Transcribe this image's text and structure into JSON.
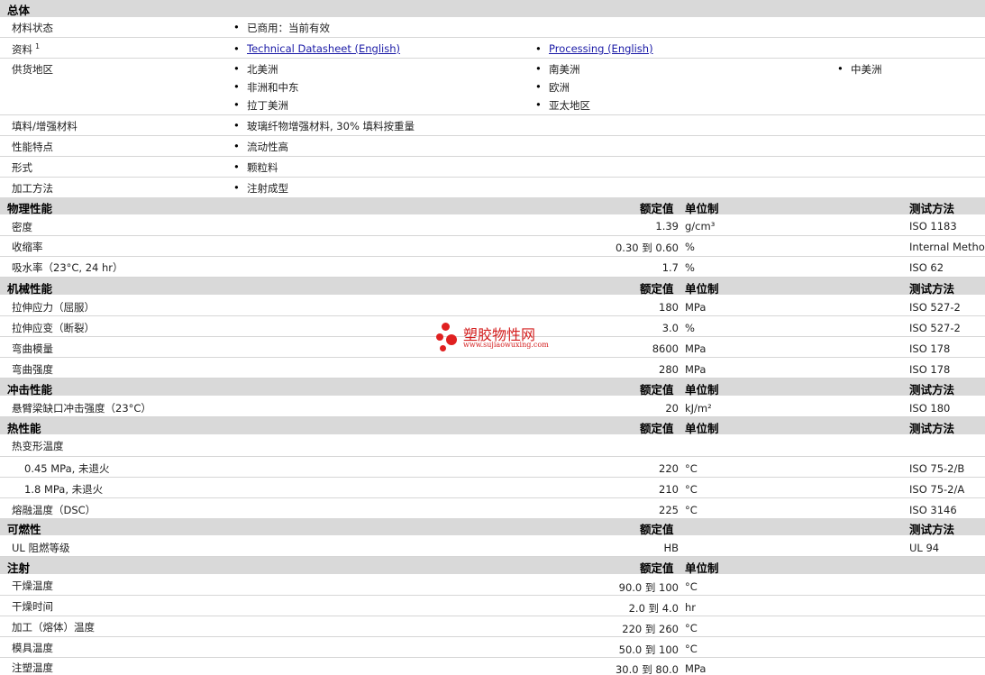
{
  "general": {
    "title": "总体",
    "status_label": "材料状态",
    "status_value": "已商用：当前有效",
    "docs_label": "资料",
    "docs_sup": "1",
    "docs_link1": "Technical Datasheet (English)",
    "docs_link2": "Processing (English)",
    "region_label": "供货地区",
    "regions": [
      "北美洲",
      "南美洲",
      "中美洲",
      "非洲和中东",
      "欧洲",
      "拉丁美洲",
      "亚太地区"
    ],
    "filler_label": "填料/增强材料",
    "filler_value": "玻璃纤物增强材料, 30% 填料按重量",
    "feature_label": "性能特点",
    "feature_value": "流动性高",
    "form_label": "形式",
    "form_value": "颗粒料",
    "process_label": "加工方法",
    "process_value": "注射成型"
  },
  "headers": {
    "nominal": "额定值",
    "unit": "单位制",
    "method": "测试方法"
  },
  "physical": {
    "title": "物理性能",
    "rows": [
      {
        "name": "密度",
        "value": "1.39",
        "unit": "g/cm³",
        "method": "ISO 1183"
      },
      {
        "name": "收缩率",
        "value": "0.30 到  0.60",
        "unit": "%",
        "method": "Internal Method"
      },
      {
        "name": "吸水率（23°C, 24 hr）",
        "value": "1.7",
        "unit": "%",
        "method": "ISO 62"
      }
    ]
  },
  "mechanical": {
    "title": "机械性能",
    "rows": [
      {
        "name": "拉伸应力（屈服）",
        "value": "180",
        "unit": "MPa",
        "method": "ISO 527-2"
      },
      {
        "name": "拉伸应变（断裂）",
        "value": "3.0",
        "unit": "%",
        "method": "ISO 527-2"
      },
      {
        "name": "弯曲模量",
        "value": "8600",
        "unit": "MPa",
        "method": "ISO 178"
      },
      {
        "name": "弯曲强度",
        "value": "280",
        "unit": "MPa",
        "method": "ISO 178"
      }
    ]
  },
  "impact": {
    "title": "冲击性能",
    "rows": [
      {
        "name": "悬臂梁缺口冲击强度（23°C）",
        "value": "20",
        "unit": "kJ/m²",
        "method": "ISO 180"
      }
    ]
  },
  "thermal": {
    "title": "热性能",
    "hdt_label": "热变形温度",
    "rows": [
      {
        "name": "0.45 MPa, 未退火",
        "value": "220",
        "unit": "°C",
        "method": "ISO 75-2/B"
      },
      {
        "name": "1.8 MPa, 未退火",
        "value": "210",
        "unit": "°C",
        "method": "ISO 75-2/A"
      },
      {
        "name": "熔融温度（DSC）",
        "value": "225",
        "unit": "°C",
        "method": "ISO 3146"
      }
    ]
  },
  "flammability": {
    "title": "可燃性",
    "rows": [
      {
        "name": "UL 阻燃等级",
        "value": "HB",
        "unit": "",
        "method": "UL 94"
      }
    ]
  },
  "injection": {
    "title": "注射",
    "rows": [
      {
        "name": "干燥温度",
        "value": "90.0 到  100",
        "unit": "°C"
      },
      {
        "name": "干燥时间",
        "value": "2.0 到  4.0",
        "unit": "hr"
      },
      {
        "name": "加工（熔体）温度",
        "value": "220 到  260",
        "unit": "°C"
      },
      {
        "name": "模具温度",
        "value": "50.0 到  100",
        "unit": "°C"
      },
      {
        "name": "注塑温度",
        "value": "30.0 到  80.0",
        "unit": "MPa"
      }
    ]
  },
  "watermark": {
    "title": "塑胶物性网",
    "url": "www.sujiaowuxing.com",
    "color": "#e02020"
  }
}
